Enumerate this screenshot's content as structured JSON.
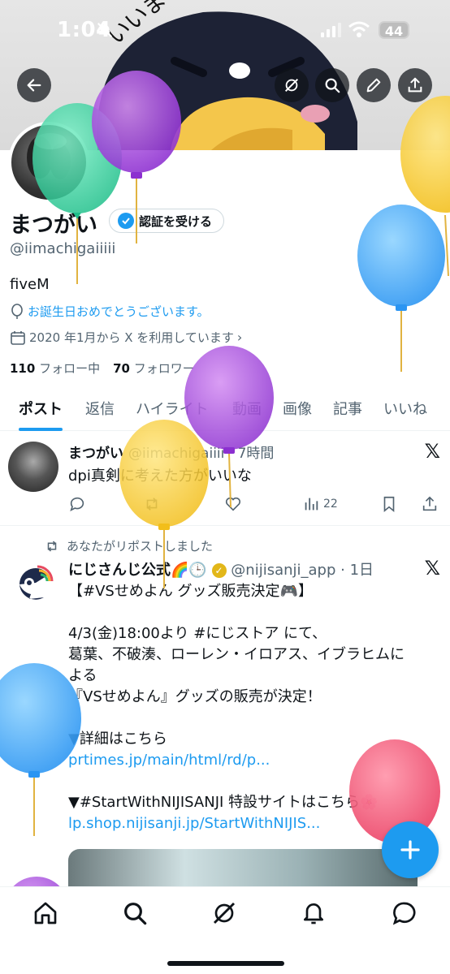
{
  "status_bar": {
    "time": "1:04",
    "battery": "44"
  },
  "profile": {
    "name": "まつがい",
    "verify_label": "認証を受ける",
    "handle": "@iimachigaiiiii",
    "bio": "fiveM",
    "birthday_text": "お誕生日おめでとうございます。",
    "joined_text": "2020 年1月から X を利用しています",
    "following_count": "110",
    "following_label": "フォロー中",
    "followers_count": "70",
    "followers_label": "フォロワー"
  },
  "tabs": [
    "ポスト",
    "返信",
    "ハイライト",
    "動画",
    "画像",
    "記事",
    "いいね"
  ],
  "post1": {
    "name": "まつがい",
    "handle_time": "@iimachigaiiii · 7時間",
    "text": "dpi真剣に考えた方がいいな",
    "views": "22"
  },
  "post2": {
    "repost_label": "あなたがリポストしました",
    "name": "にじさんじ公式🌈🕒",
    "handle_time": "@nijisanji_app · 1日",
    "lines": [
      "【#VSせめよん グッズ販売決定🎮】",
      "",
      "4/3(金)18:00より #にじストア にて、",
      "葛葉、不破湊、ローレン・イロアス、イブラヒムに",
      "よる",
      "『VSせめよん』グッズの販売が決定！",
      "",
      "▼詳細はこちら",
      "prtimes.jp/main/html/rd/p...",
      "",
      "▼#StartWithNIJISANJI 特設サイトはこちら🌸",
      "lp.shop.nijisanji.jp/StartWithNIJIS..."
    ]
  },
  "colors": {
    "accent": "#1d9bf0",
    "text": "#0f1419",
    "secondary": "#536471"
  },
  "icons": [
    "back-icon",
    "grok-icon",
    "search-icon",
    "edit-icon",
    "share-icon",
    "home-icon",
    "explore-icon",
    "communities-icon",
    "notifications-icon",
    "messages-icon",
    "compose-icon"
  ]
}
